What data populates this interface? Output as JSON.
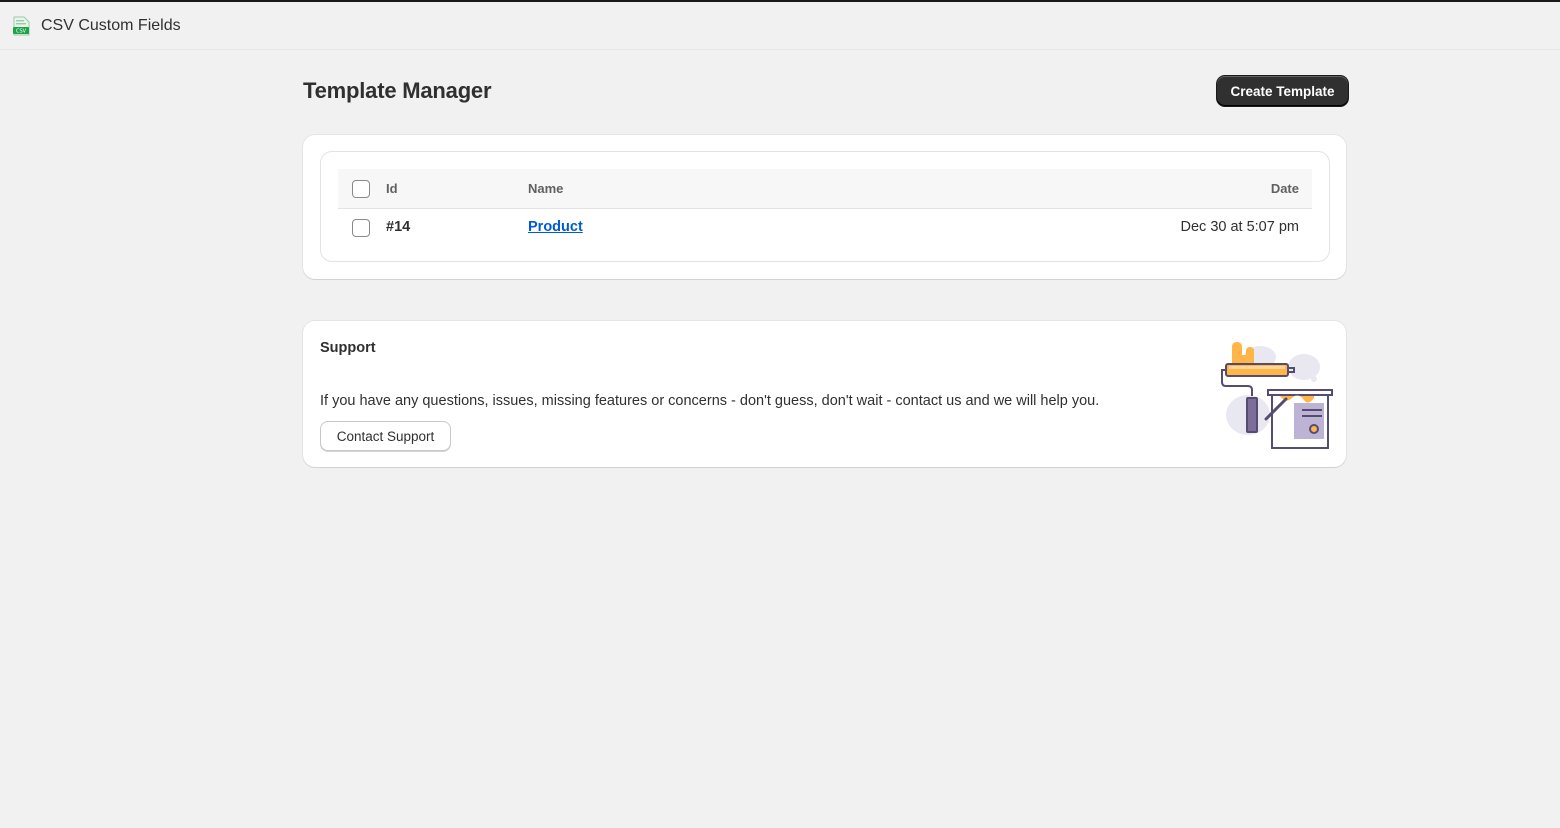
{
  "app": {
    "title": "CSV Custom Fields",
    "icon": "csv-file-icon",
    "icon_text": "CSV",
    "accent_color": "#1fa34a"
  },
  "page": {
    "title": "Template Manager",
    "create_button_label": "Create Template"
  },
  "templates_table": {
    "headers": {
      "id": "Id",
      "name": "Name",
      "date": "Date"
    },
    "rows": [
      {
        "id": "#14",
        "name": "Product",
        "date": "Dec 30 at 5:07 pm"
      }
    ]
  },
  "support": {
    "title": "Support",
    "text": "If you have any questions, issues, missing features or concerns - don't guess, don't wait - contact us and we will help you.",
    "button_label": "Contact Support",
    "illustration": "paint-roller-and-bucket-illustration"
  },
  "colors": {
    "primary_button": "#303030",
    "link": "#005bd3",
    "background": "#f1f1f1",
    "illustration_orange": "#ffb547",
    "illustration_purple": "#7d6e99"
  }
}
